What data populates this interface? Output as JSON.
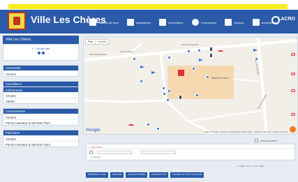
{
  "header": {
    "title": "Ville Les Chères",
    "nav": [
      "Tableau de bord",
      "Installations",
      "Surveillance",
      "Commandes",
      "Analyse",
      "Administration"
    ],
    "brand": "LACRO"
  },
  "sidebar": {
    "heading": "Ville Les Chères",
    "commune_label": "1 - Centre-ville",
    "sections": [
      {
        "title": "Commande",
        "items": [
          "Armoire"
        ]
      },
      {
        "title": "Surveillance",
        "items": [
          "Evènements",
          "Armoire",
          "Alertes"
        ],
        "active": 0
      },
      {
        "title": "Consommation",
        "items": [
          "Armoire",
          "Points Lumineux & Services Tiers"
        ]
      },
      {
        "title": "Patrimoine",
        "items": [
          "Armoire",
          "Points Lumineux & Services Tiers"
        ]
      }
    ]
  },
  "map": {
    "type_buttons": [
      "Plan",
      "Satellite"
    ],
    "google_label": "Google",
    "attribution": "Raccourcis clavier · Données cartographiques ©2021 Google · Conditions d'utilisation · Signaler une erreur",
    "mairie_label": "Mairie de Lacro",
    "streets": [
      "Rue du Moulin",
      "Rue de Beaujolais",
      "Rue de Beaujolais",
      "Rue des Saulniers",
      "Rue de la Bresse"
    ]
  },
  "panel": {
    "checkbox_label": "Incidents préfiltrés",
    "row1_text": "Aucun Alerte",
    "row2_placeholders": [
      "Pour suite",
      "Supprimer"
    ],
    "row3_text": "1 sites Mo",
    "pager": "« ‹ Page 1 sur 1 › » 10 / page",
    "actions": [
      "EXPORTER LA LISTE",
      "ARCHIVER",
      "ARCHIVER TRIABLE",
      "ARCHIVER TOUT",
      "CHANGER LE STATUT D'ANALYSE"
    ]
  },
  "colors": {
    "primary": "#2a5aa8",
    "accent": "#f7ec1a",
    "alert": "#e0312c"
  }
}
